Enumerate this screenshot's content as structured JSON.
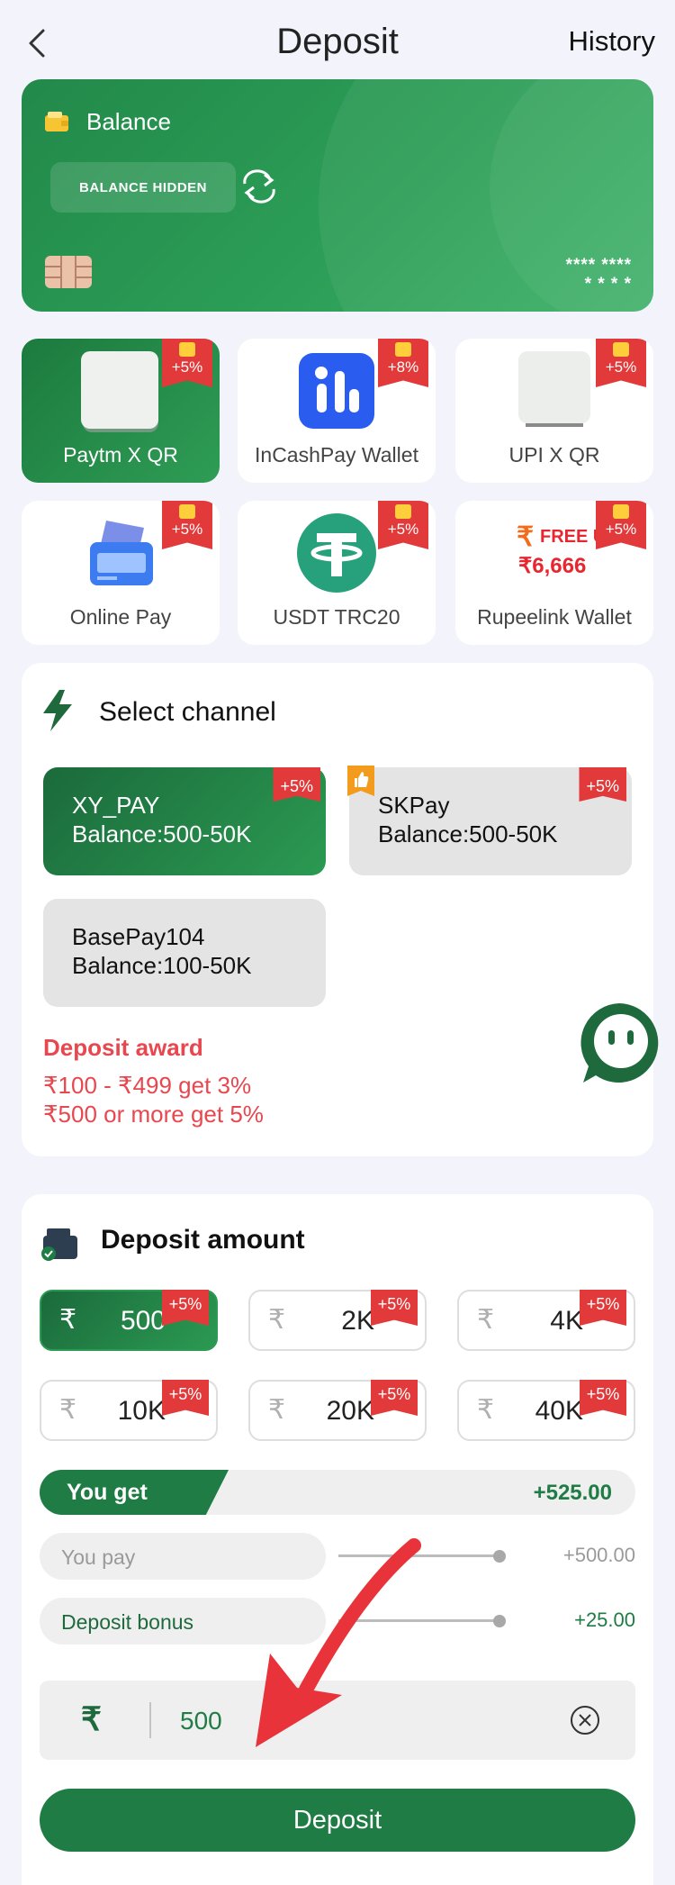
{
  "header": {
    "title": "Deposit",
    "history": "History"
  },
  "balance_card": {
    "label": "Balance",
    "hidden_text": "BALANCE HIDDEN",
    "card_number_line1": "**** ****",
    "card_number_line2": "* * * *"
  },
  "payment_methods": [
    {
      "label": "Paytm X QR",
      "bonus": "+5%",
      "icon": "qr-placeholder-icon",
      "selected": true
    },
    {
      "label": "InCashPay Wallet",
      "bonus": "+8%",
      "icon": "incashpay-logo-icon",
      "selected": false
    },
    {
      "label": "UPI X QR",
      "bonus": "+5%",
      "icon": "qr-placeholder-icon",
      "selected": false
    },
    {
      "label": "Online Pay",
      "bonus": "+5%",
      "icon": "card-icon",
      "selected": false
    },
    {
      "label": "USDT TRC20",
      "bonus": "+5%",
      "icon": "tether-icon",
      "selected": false
    },
    {
      "label": "Rupeelink Wallet",
      "bonus": "+5%",
      "icon": "free-up-promo-icon",
      "selected": false,
      "promo_text": "FREE UP",
      "promo_amount": "₹6,666"
    }
  ],
  "channel": {
    "title": "Select channel",
    "options": [
      {
        "name": "XY_PAY",
        "range": "Balance:500-50K",
        "bonus": "+5%",
        "selected": true
      },
      {
        "name": "SKPay",
        "range": "Balance:500-50K",
        "bonus": "+5%",
        "selected": false,
        "recommended": true
      },
      {
        "name": "BasePay104",
        "range": "Balance:100-50K",
        "bonus": "",
        "selected": false
      }
    ],
    "award_title": "Deposit award",
    "award_lines": [
      "₹100 - ₹499 get 3%",
      "₹500 or more get 5%"
    ]
  },
  "amount": {
    "title": "Deposit amount",
    "currency": "₹",
    "options": [
      {
        "value": "500",
        "bonus": "+5%",
        "selected": true
      },
      {
        "value": "2K",
        "bonus": "+5%",
        "selected": false
      },
      {
        "value": "4K",
        "bonus": "+5%",
        "selected": false
      },
      {
        "value": "10K",
        "bonus": "+5%",
        "selected": false
      },
      {
        "value": "20K",
        "bonus": "+5%",
        "selected": false
      },
      {
        "value": "40K",
        "bonus": "+5%",
        "selected": false
      }
    ],
    "you_get_label": "You get",
    "you_get_value": "+525.00",
    "you_pay_label": "You pay",
    "you_pay_value": "+500.00",
    "bonus_label": "Deposit bonus",
    "bonus_value": "+25.00",
    "input_value": "500",
    "submit_label": "Deposit"
  },
  "colors": {
    "brand_green": "#1e7c44",
    "badge_red": "#e23a3a",
    "award_red": "#e8474f",
    "arrow_red": "#e8333a"
  }
}
